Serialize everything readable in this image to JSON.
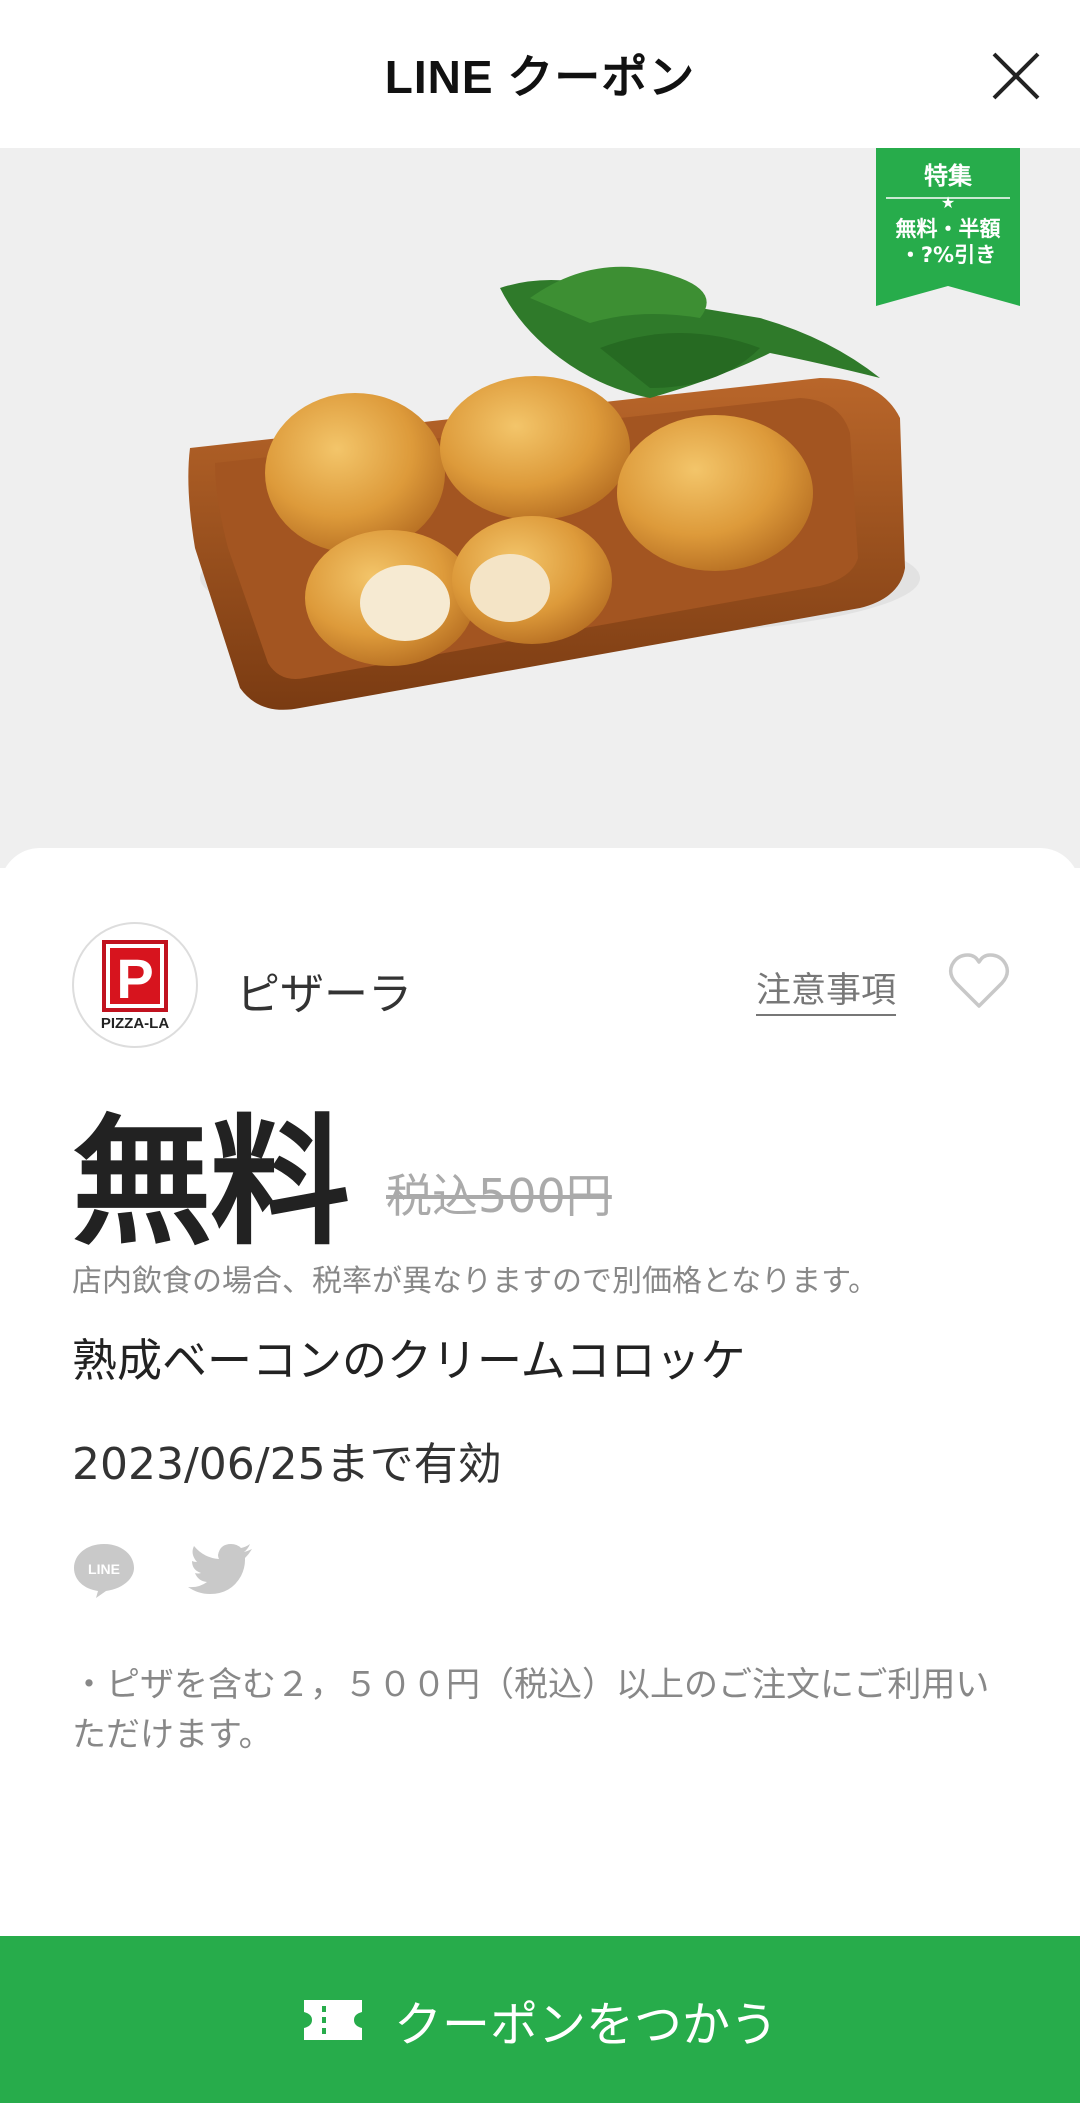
{
  "header": {
    "title": "LINE クーポン"
  },
  "ribbon": {
    "line1": "特集",
    "line2": "無料・半額",
    "line3": "・?%引き",
    "star": "★",
    "color": "#27ac4b"
  },
  "brand": {
    "name": "ピザーラ",
    "logo_text": "PIZZA-LA",
    "logo_letter": "P"
  },
  "notice_link": "注意事項",
  "price": {
    "main": "無料",
    "original": "税込500円"
  },
  "tax_note": "店内飲食の場合、税率が異なりますので別価格となります。",
  "product_name": "熟成ベーコンのクリームコロッケ",
  "valid_until": "2023/06/25まで有効",
  "share": {
    "line_label": "LINE"
  },
  "terms": "・ピザを含む２，５００円（税込）以上のご注文にご利用いただけます。",
  "cta": {
    "label": "クーポンをつかう",
    "color": "#27ac4b"
  }
}
